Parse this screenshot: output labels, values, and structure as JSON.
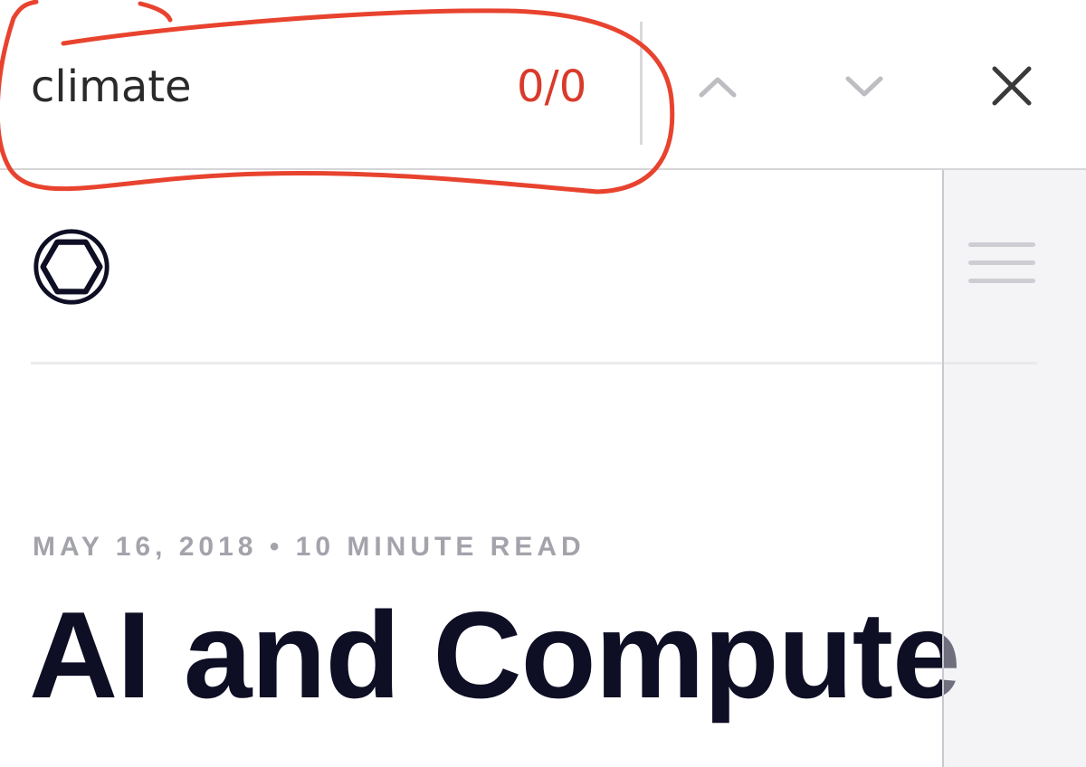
{
  "find_bar": {
    "query": "climate",
    "match_count": "0/0",
    "icons": {
      "previous": "chevron-up-icon",
      "next": "chevron-down-icon",
      "close": "close-icon"
    }
  },
  "annotation": {
    "shape": "hand-drawn-circle",
    "color": "#e8432f"
  },
  "page": {
    "logo": "openai-logo",
    "menu_icon": "hamburger-menu-icon",
    "article": {
      "meta": "MAY 16, 2018 • 10 MINUTE READ",
      "title": "AI and Compute"
    }
  },
  "colors": {
    "match_count": "#d93a2b",
    "title": "#0e0e24",
    "meta": "#a3a3ab",
    "annotation": "#e8432f"
  }
}
